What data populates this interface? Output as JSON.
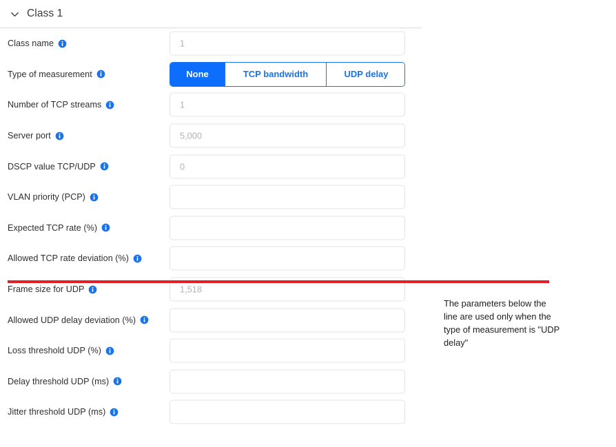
{
  "section": {
    "title": "Class 1",
    "chevron": "chevron-down-icon",
    "expanded": true
  },
  "colors": {
    "accent": "#1a73e8",
    "active_segment_bg": "#0d6efd",
    "info_icon": "#1a73e8",
    "red_divider": "#e31e26",
    "input_border": "#e2e3e5",
    "placeholder": "#b2b2b2",
    "header_divider": "#dcdcdc"
  },
  "form": {
    "rows": [
      {
        "label": "Class name",
        "info": "info-icon",
        "control": "text",
        "name": "class-name-input",
        "value": "",
        "placeholder": "1"
      },
      {
        "label": "Type of measurement",
        "info": "info-icon",
        "control": "segmented",
        "name": "type-of-measurement-segmented",
        "options": [
          "None",
          "TCP bandwidth",
          "UDP delay"
        ],
        "selected": "None"
      },
      {
        "label": "Number of TCP streams",
        "info": "info-icon",
        "control": "text",
        "name": "number-of-tcp-streams-input",
        "value": "",
        "placeholder": "1"
      },
      {
        "label": "Server port",
        "info": "info-icon",
        "control": "text",
        "name": "server-port-input",
        "value": "",
        "placeholder": "5,000"
      },
      {
        "label": "DSCP value TCP/UDP",
        "info": "info-icon",
        "control": "text",
        "name": "dscp-value-input",
        "value": "",
        "placeholder": "0"
      },
      {
        "label": "VLAN priority (PCP)",
        "info": "info-icon",
        "control": "text",
        "name": "vlan-priority-input",
        "value": "",
        "placeholder": ""
      },
      {
        "label": "Expected TCP rate (%)",
        "info": "info-icon",
        "control": "text",
        "name": "expected-tcp-rate-input",
        "value": "",
        "placeholder": ""
      },
      {
        "label": "Allowed TCP rate deviation (%)",
        "info": "info-icon",
        "control": "text",
        "name": "allowed-tcp-rate-deviation-input",
        "value": "",
        "placeholder": ""
      },
      {
        "label": "Frame size for UDP",
        "info": "info-icon",
        "control": "text",
        "name": "frame-size-for-udp-input",
        "value": "",
        "placeholder": "1,518"
      },
      {
        "label": "Allowed UDP delay deviation (%)",
        "info": "info-icon",
        "control": "text",
        "name": "allowed-udp-delay-deviation-input",
        "value": "",
        "placeholder": ""
      },
      {
        "label": "Loss threshold UDP (%)",
        "info": "info-icon",
        "control": "text",
        "name": "loss-threshold-udp-input",
        "value": "",
        "placeholder": ""
      },
      {
        "label": "Delay threshold UDP (ms)",
        "info": "info-icon",
        "control": "text",
        "name": "delay-threshold-udp-input",
        "value": "",
        "placeholder": ""
      },
      {
        "label": "Jitter threshold UDP (ms)",
        "info": "info-icon",
        "control": "text",
        "name": "jitter-threshold-udp-input",
        "value": "",
        "placeholder": ""
      }
    ]
  },
  "annotation": {
    "text": "The parameters below the line are used only when the type of measurement is \"UDP delay\""
  }
}
